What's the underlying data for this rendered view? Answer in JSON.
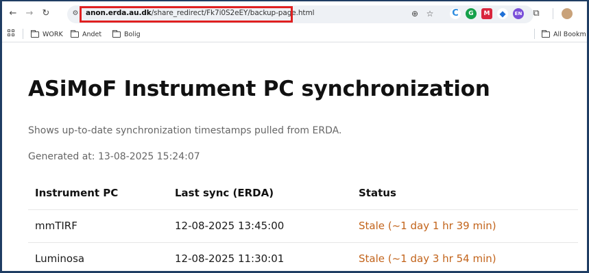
{
  "browser": {
    "url_host": "anon.erda.au.dk",
    "url_path": "/share_redirect/Fk7i0S2eEY/backup-page.html",
    "extensions": [
      {
        "icon": "grammar-check-icon",
        "color": "#2b8be0",
        "text": "C"
      },
      {
        "icon": "grammarly-icon",
        "color": "#15a04a",
        "text": "G"
      },
      {
        "icon": "mendeley-icon",
        "color": "#d9263d",
        "text": "M"
      },
      {
        "icon": "zotero-icon",
        "color": "#1f6fd6",
        "text": "◆"
      },
      {
        "icon": "language-icon",
        "color": "#7a4fd9",
        "text": "EN"
      }
    ]
  },
  "bookmarks": {
    "items": [
      "WORK",
      "Andet",
      "Bolig"
    ],
    "all_bookmarks": "All Bookm"
  },
  "page": {
    "title": "ASiMoF Instrument PC synchronization",
    "subtitle": "Shows up-to-date synchronization timestamps pulled from ERDA.",
    "generated": "Generated at: 13-08-2025 15:24:07"
  },
  "table": {
    "headers": [
      "Instrument PC",
      "Last sync (ERDA)",
      "Status"
    ],
    "rows": [
      [
        "mmTIRF",
        "12-08-2025 13:45:00",
        "Stale (~1 day 1 hr 39 min)"
      ],
      [
        "Luminosa",
        "12-08-2025 11:30:01",
        "Stale (~1 day 3 hr 54 min)"
      ]
    ]
  },
  "colors": {
    "stale": "#c2631a",
    "url_highlight": "#e02020"
  }
}
